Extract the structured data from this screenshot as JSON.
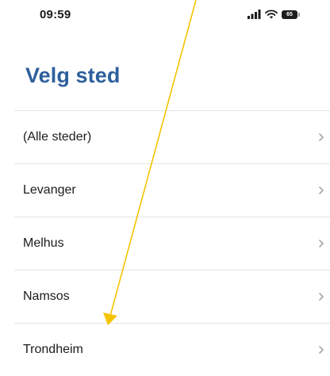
{
  "status_bar": {
    "time": "09:59",
    "battery_level": "65",
    "icons": [
      "signal-icon",
      "wifi-icon",
      "battery-icon"
    ]
  },
  "header": {
    "title": "Velg sted"
  },
  "places": [
    {
      "label": "(Alle steder)"
    },
    {
      "label": "Levanger"
    },
    {
      "label": "Melhus"
    },
    {
      "label": "Namsos"
    },
    {
      "label": "Trondheim"
    }
  ],
  "annotation": {
    "type": "arrow",
    "color": "#f5c400",
    "target": "Trondheim"
  },
  "colors": {
    "title": "#2e5f9c",
    "text": "#1c1c1e",
    "separator": "#e4e4e6",
    "chevron": "#a7a7ab"
  }
}
